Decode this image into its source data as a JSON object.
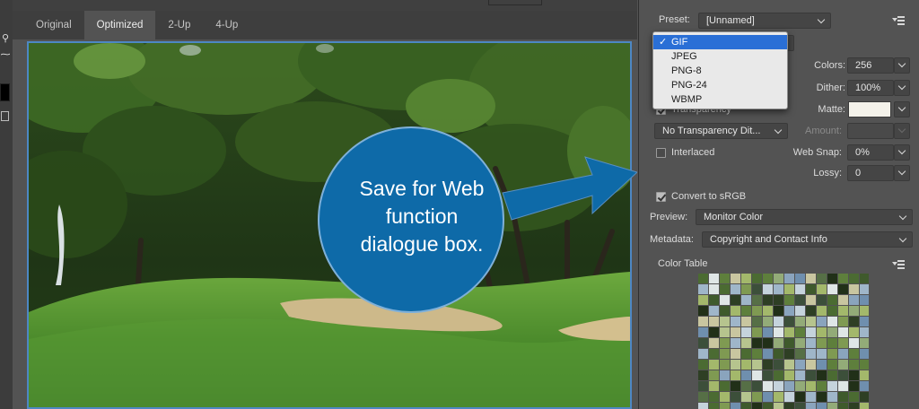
{
  "tabs": [
    {
      "label": "Original",
      "active": false
    },
    {
      "label": "Optimized",
      "active": true
    },
    {
      "label": "2-Up",
      "active": false
    },
    {
      "label": "4-Up",
      "active": false
    }
  ],
  "callout": {
    "lines": [
      "Save for Web",
      "function",
      "dialogue box."
    ],
    "color": "#0e6aa8"
  },
  "settings": {
    "preset_label": "Preset:",
    "preset_value": "[Unnamed]",
    "format_options": [
      "GIF",
      "JPEG",
      "PNG-8",
      "PNG-24",
      "WBMP"
    ],
    "format_selected": "GIF",
    "colors_label": "Colors:",
    "colors_value": "256",
    "dither_label": "Dither:",
    "dither_value": "100%",
    "transparency_label": "Transparency",
    "matte_label": "Matte:",
    "matte_color": "#f4f2ea",
    "transparency_dither_value": "No Transparency Dit...",
    "amount_label": "Amount:",
    "interlaced_label": "Interlaced",
    "interlaced_checked": false,
    "web_snap_label": "Web Snap:",
    "web_snap_value": "0%",
    "lossy_label": "Lossy:",
    "lossy_value": "0",
    "convert_srgb_label": "Convert to sRGB",
    "convert_srgb_checked": true,
    "preview_label": "Preview:",
    "preview_value": "Monitor Color",
    "metadata_label": "Metadata:",
    "metadata_value": "Copyright and Contact Info",
    "color_table_label": "Color Table"
  },
  "color_table_palette": [
    "#7f9a52",
    "#5e7f3c",
    "#9fb6c9",
    "#3f5a2c",
    "#c9c6a0",
    "#2e3f24",
    "#6f8fae",
    "#a3b86b",
    "#4b6b32",
    "#dfe6e6",
    "#8aa4bd",
    "#213018",
    "#b6c48e",
    "#566f46",
    "#93ab78",
    "#3c4f3a",
    "#c5d3dc"
  ]
}
